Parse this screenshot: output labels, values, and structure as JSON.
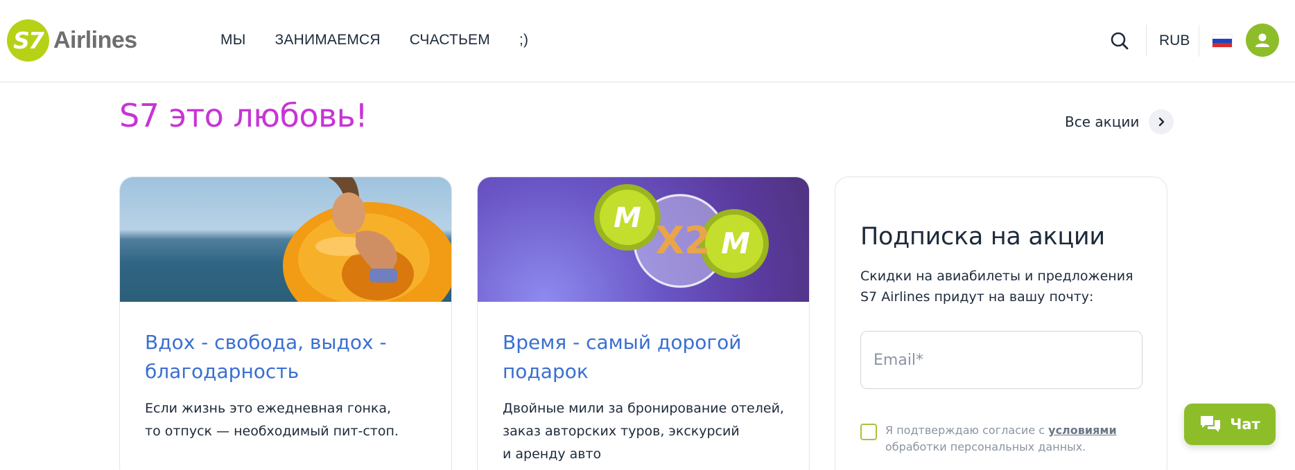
{
  "header": {
    "logo_mark": "S7",
    "logo_text": "Airlines",
    "nav": [
      "МЫ",
      "ЗАНИМАЕМСЯ",
      "СЧАСТЬЕМ",
      ";)"
    ],
    "currency": "RUB",
    "flag_colors": [
      "#ffffff",
      "#1b45c4",
      "#d92a2a"
    ],
    "search_icon": "search-icon",
    "user_icon": "user-icon"
  },
  "section": {
    "title": "S7 это любовь!",
    "all_promos_label": "Все акции"
  },
  "cards": [
    {
      "title": "Вдох - свобода, выдох - благодарность",
      "text_line1": "Если жизнь это ежедневная гонка,",
      "text_line2": "то отпуск — необходимый пит-стоп."
    },
    {
      "title": "Время - самый дорогой подарок",
      "text_line1": "Двойные мили за бронирование отелей,",
      "text_line2": "заказ авторских туров, экскурсий",
      "text_line3": "и аренду авто",
      "badge_left": "М",
      "badge_center": "X2",
      "badge_right": "М"
    }
  ],
  "subscribe": {
    "title": "Подписка на акции",
    "desc_line1": "Скидки на авиабилеты и предложения",
    "desc_line2": "S7 Airlines придут на вашу почту:",
    "email_placeholder": "Email*",
    "consent_prefix": "Я подтверждаю согласие с ",
    "consent_link": "условиями",
    "consent_suffix": " обработки персональных данных."
  },
  "chat": {
    "label": "Чат"
  },
  "colors": {
    "brand_green": "#8dbe2a",
    "logo_green": "#b7d117",
    "title_pink": "#c734d6",
    "link_blue": "#3a6fd0"
  }
}
